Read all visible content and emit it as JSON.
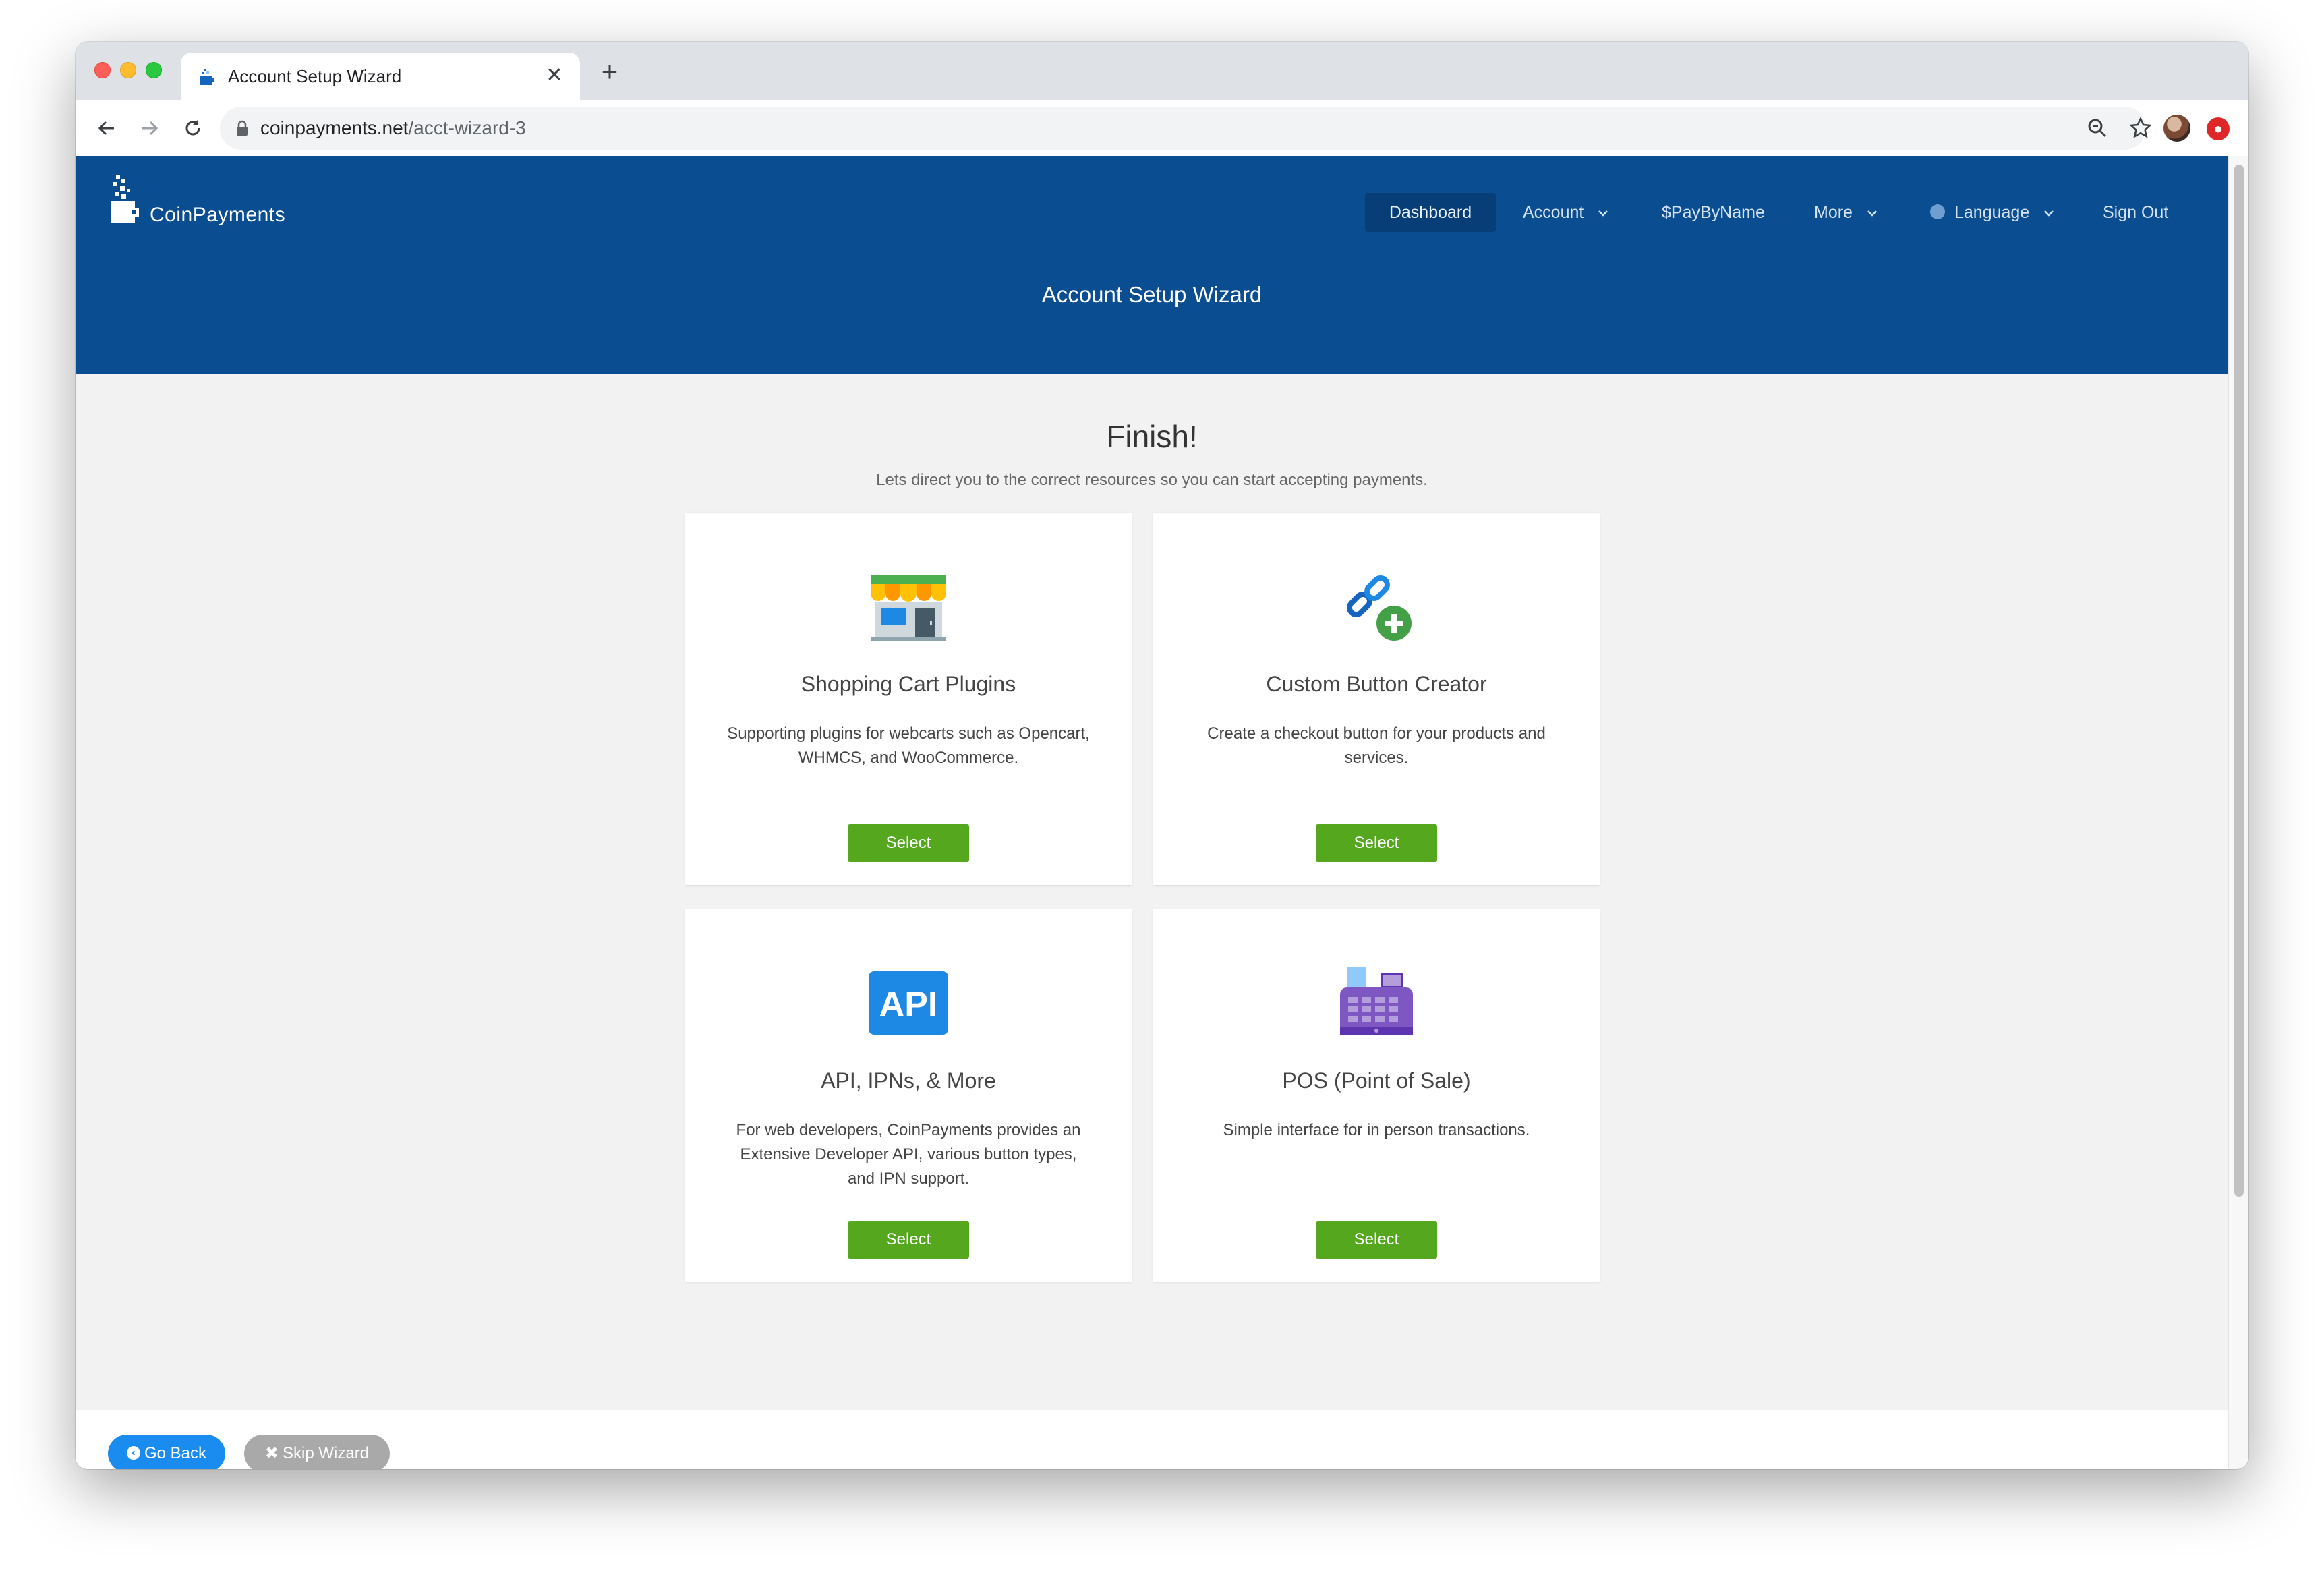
{
  "browser": {
    "tab_title": "Account Setup Wizard",
    "url_domain": "coinpayments.net",
    "url_path": "/acct-wizard-3"
  },
  "header": {
    "logo_text": "CoinPayments",
    "nav": {
      "dashboard": "Dashboard",
      "account": "Account",
      "paybyname": "$PayByName",
      "more": "More",
      "language": "Language",
      "signout": "Sign Out"
    },
    "page_title": "Account Setup Wizard"
  },
  "main": {
    "title": "Finish!",
    "subtitle": "Lets direct you to the correct resources so you can start accepting payments.",
    "cards": [
      {
        "icon": "storefront-icon",
        "title": "Shopping Cart Plugins",
        "description": "Supporting plugins for webcarts such as Opencart, WHMCS, and WooCommerce.",
        "button": "Select"
      },
      {
        "icon": "link-add-icon",
        "title": "Custom Button Creator",
        "description": "Create a checkout button for your products and services.",
        "button": "Select"
      },
      {
        "icon": "api-icon",
        "icon_text": "API",
        "title": "API, IPNs, & More",
        "description": "For web developers, CoinPayments provides an Extensive Developer API, various button types, and IPN support.",
        "button": "Select"
      },
      {
        "icon": "cash-register-icon",
        "title": "POS (Point of Sale)",
        "description": "Simple interface for in person transactions.",
        "button": "Select"
      }
    ]
  },
  "footer": {
    "go_back": "Go Back",
    "skip_wizard": "Skip Wizard"
  },
  "colors": {
    "header_bg": "#0a4d91",
    "select_button": "#55a81e",
    "go_back_button": "#1a8cf0",
    "skip_button": "#a9a9a9"
  }
}
